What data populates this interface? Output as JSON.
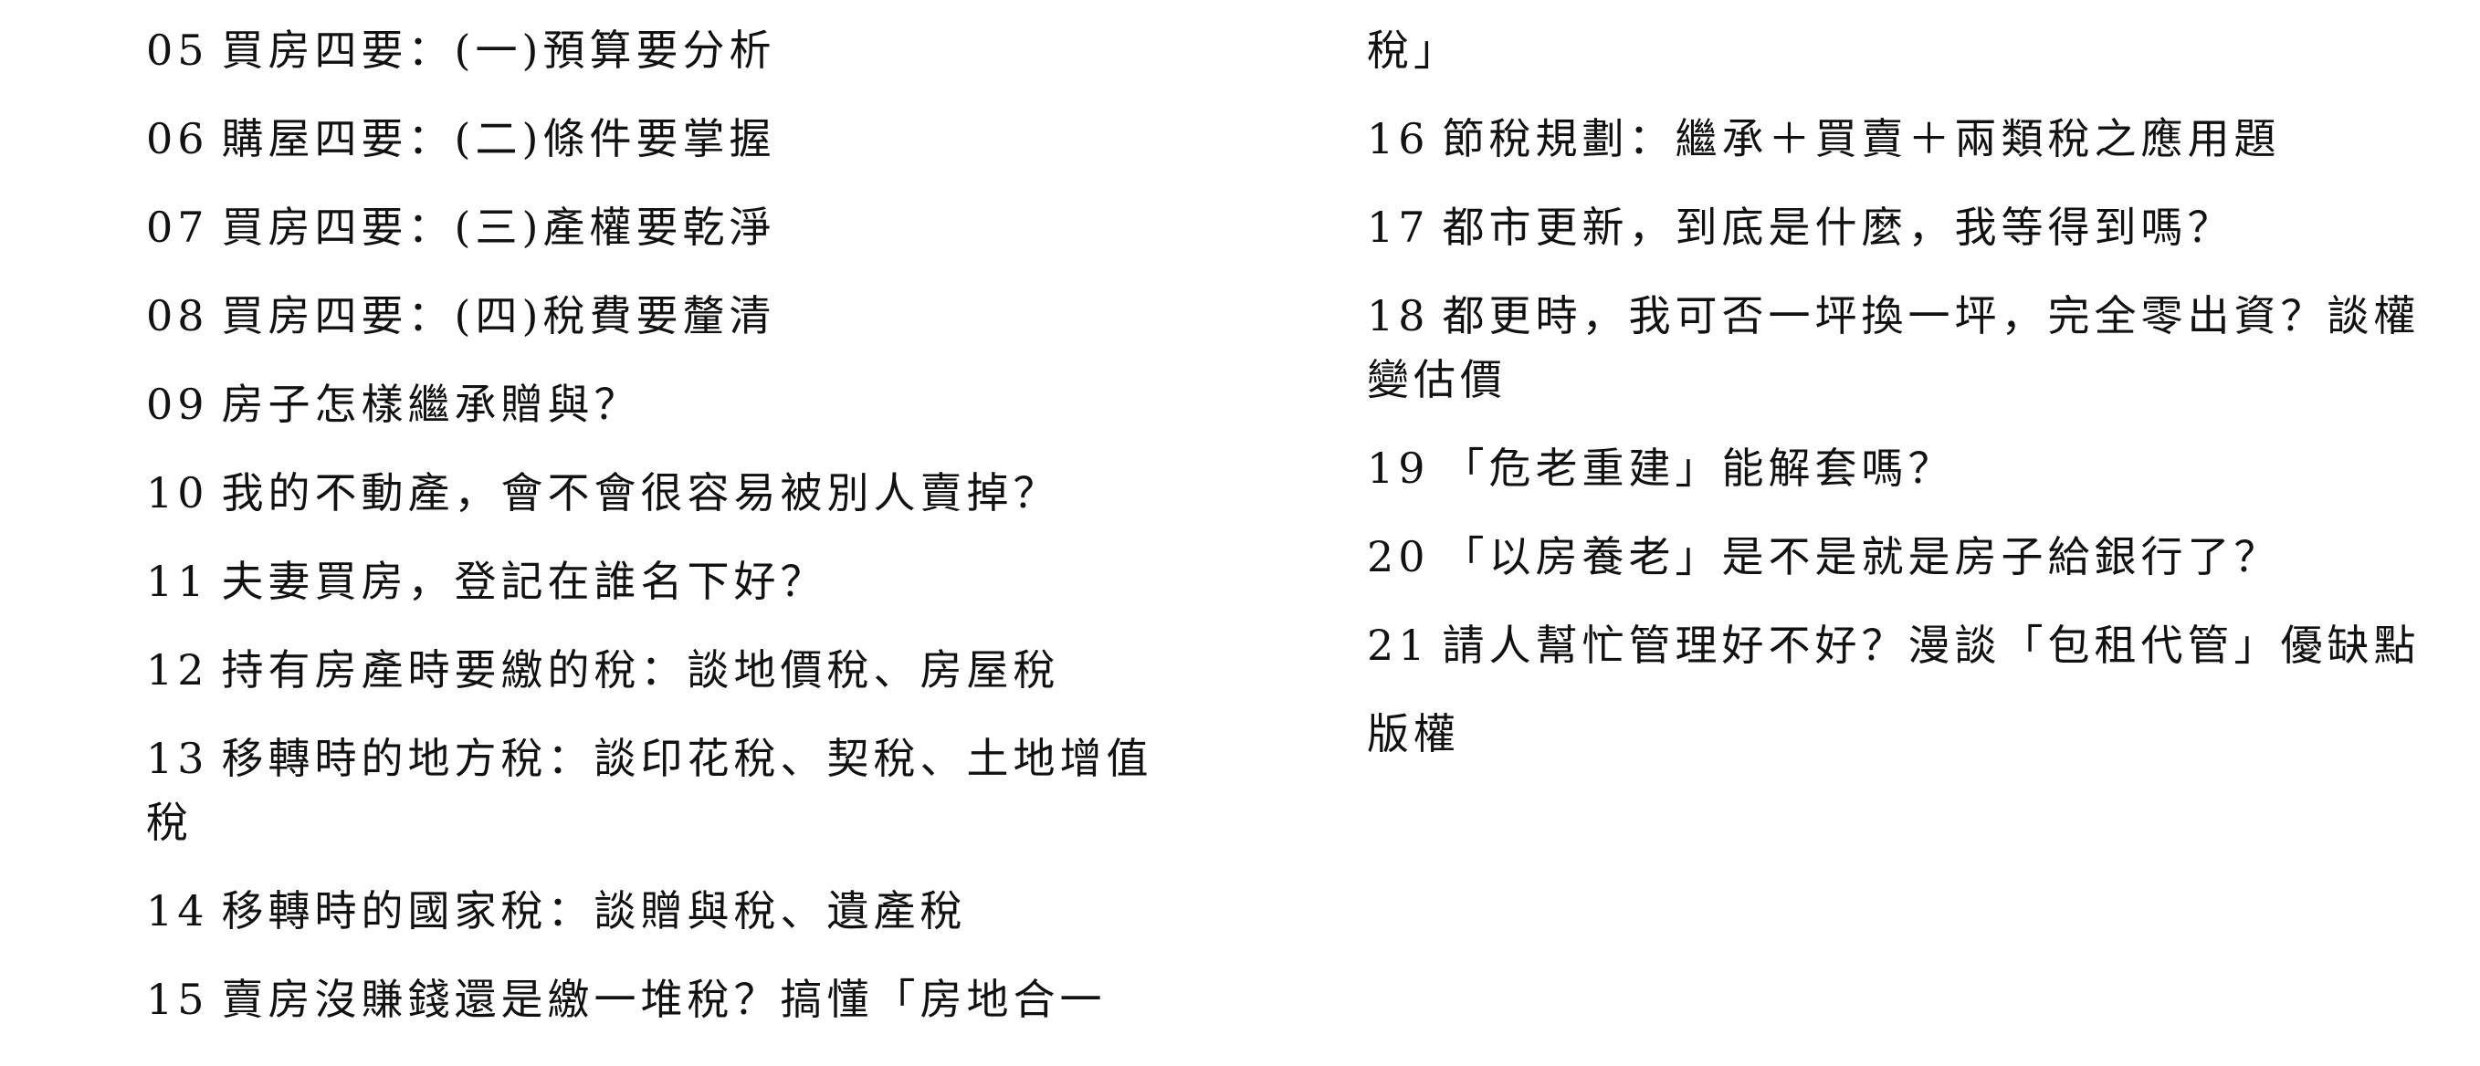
{
  "left_column": [
    {
      "num": "05",
      "text": "買房四要：(一)預算要分析"
    },
    {
      "num": "06",
      "text": "購屋四要：(二)條件要掌握"
    },
    {
      "num": "07",
      "text": "買房四要：(三)產權要乾淨"
    },
    {
      "num": "08",
      "text": "買房四要：(四)稅費要釐清"
    },
    {
      "num": "09",
      "text": "房子怎樣繼承贈與？"
    },
    {
      "num": "10",
      "text": "我的不動產，會不會很容易被別人賣掉？"
    },
    {
      "num": "11",
      "text": "夫妻買房，登記在誰名下好？"
    },
    {
      "num": "12",
      "text": "持有房產時要繳的稅：談地價稅、房屋稅"
    },
    {
      "num": "13",
      "text": "移轉時的地方稅：談印花稅、契稅、土地增值稅"
    },
    {
      "num": "14",
      "text": "移轉時的國家稅：談贈與稅、遺產稅"
    },
    {
      "num": "15",
      "text": "賣房沒賺錢還是繳一堆稅？搞懂「房地合一"
    }
  ],
  "right_column": [
    {
      "num": "",
      "text": "稅」"
    },
    {
      "num": "16",
      "text": "節稅規劃：繼承＋買賣＋兩類稅之應用題"
    },
    {
      "num": "17",
      "text": "都市更新，到底是什麼，我等得到嗎？"
    },
    {
      "num": "18",
      "text": "都更時，我可否一坪換一坪，完全零出資？談權變估價"
    },
    {
      "num": "19",
      "text": "「危老重建」能解套嗎？"
    },
    {
      "num": "20",
      "text": "「以房養老」是不是就是房子給銀行了？"
    },
    {
      "num": "21",
      "text": "請人幫忙管理好不好？漫談「包租代管」優缺點"
    },
    {
      "num": "",
      "text": "版權"
    }
  ]
}
